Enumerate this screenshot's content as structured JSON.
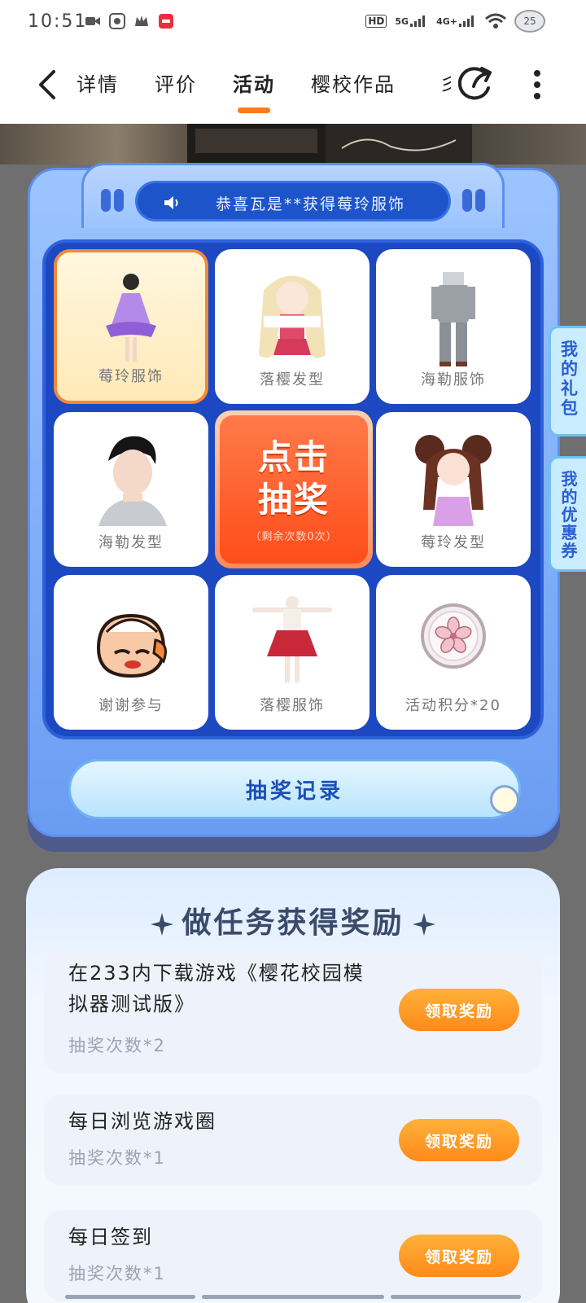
{
  "status_bar": {
    "time": "10:51",
    "network_1": "HD",
    "network_2": "5G",
    "network_3": "4G+",
    "battery": "25"
  },
  "nav": {
    "tabs": [
      {
        "label": "详情"
      },
      {
        "label": "评价"
      },
      {
        "label": "活动"
      },
      {
        "label": "樱校作品"
      }
    ],
    "overflow_hint": "彡"
  },
  "lottery": {
    "notice": "恭喜瓦是**获得莓玲服饰",
    "prizes": [
      {
        "label": "莓玲服饰",
        "icon": "purple-dress-outfit-icon"
      },
      {
        "label": "落樱发型",
        "icon": "blonde-hairstyle-icon"
      },
      {
        "label": "海勒服饰",
        "icon": "grey-uniform-outfit-icon"
      },
      {
        "label": "海勒发型",
        "icon": "dark-hairstyle-icon"
      },
      {
        "label": "莓玲发型",
        "icon": "brown-twin-hairstyle-icon"
      },
      {
        "label": "谢谢参与",
        "icon": "mascot-face-icon"
      },
      {
        "label": "落樱服饰",
        "icon": "red-dress-outfit-icon"
      },
      {
        "label": "活动积分*20",
        "icon": "sakura-coin-icon"
      }
    ],
    "draw_button": {
      "line1": "点击",
      "line2": "抽奖",
      "sub": "（剩余次数0次）"
    },
    "record_button": "抽奖记录"
  },
  "side_tabs": {
    "gift": "我的礼包",
    "coupon": "我的优惠券"
  },
  "tasks": {
    "title": "做任务获得奖励",
    "items": [
      {
        "name": "在233内下载游戏《樱花校园模拟器测试版》",
        "count": "抽奖次数*2",
        "button": "领取奖励"
      },
      {
        "name": "每日浏览游戏圈",
        "count": "抽奖次数*1",
        "button": "领取奖励"
      },
      {
        "name": "每日签到",
        "count": "抽奖次数*1",
        "button": "领取奖励"
      }
    ]
  },
  "colors": {
    "accent_orange": "#ff7a1a",
    "board_blue": "#1c48c2",
    "notice_blue": "#1d54c9"
  }
}
